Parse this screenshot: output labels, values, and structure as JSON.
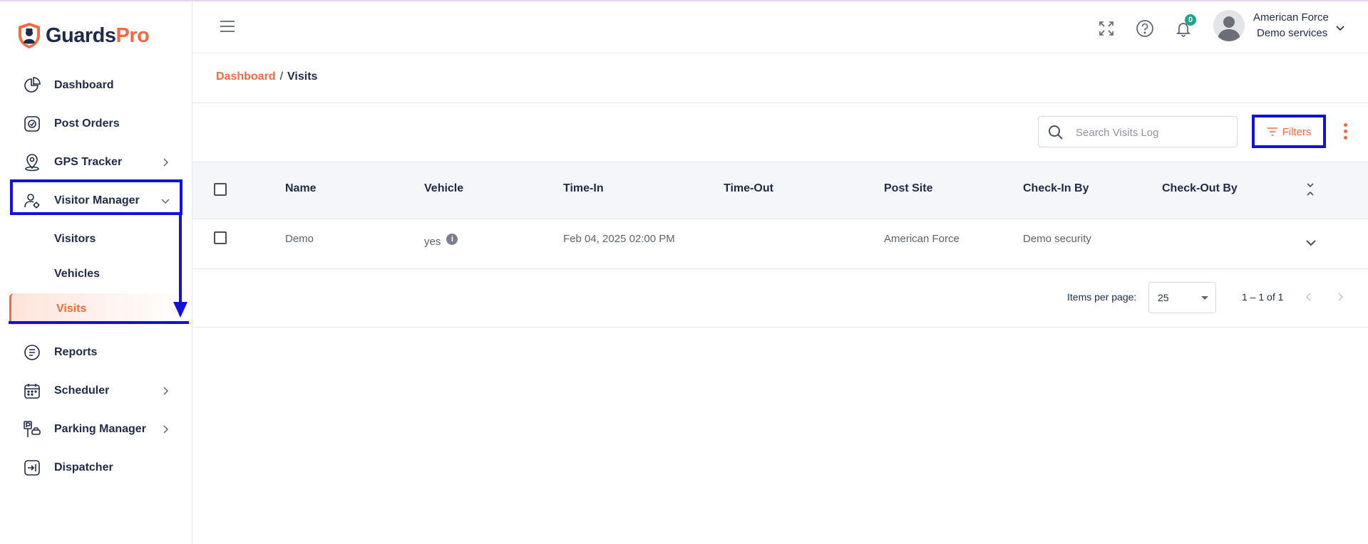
{
  "brand": {
    "name_part1": "Guards",
    "name_part2": "Pro",
    "accent_color": "#f26a3d",
    "annotation_color": "#1010e0"
  },
  "sidebar": {
    "items": [
      {
        "label": "Dashboard",
        "icon": "pie-chart-icon"
      },
      {
        "label": "Post Orders",
        "icon": "id-badge-icon"
      },
      {
        "label": "GPS Tracker",
        "icon": "map-pin-icon"
      },
      {
        "label": "Visitor Manager",
        "icon": "user-gear-icon"
      },
      {
        "label": "Reports",
        "icon": "report-icon"
      },
      {
        "label": "Scheduler",
        "icon": "calendar-icon"
      },
      {
        "label": "Parking Manager",
        "icon": "parking-icon"
      },
      {
        "label": "Dispatcher",
        "icon": "dispatch-icon"
      }
    ],
    "visitor_sub": [
      {
        "label": "Visitors"
      },
      {
        "label": "Vehicles"
      },
      {
        "label": "Visits",
        "active": true
      }
    ]
  },
  "header": {
    "notification_count": "0",
    "user_name": "American Force",
    "user_org": "Demo services"
  },
  "breadcrumb": {
    "root": "Dashboard",
    "separator": "/",
    "current": "Visits"
  },
  "toolbar": {
    "search_placeholder": "Search Visits Log",
    "filters_label": "Filters"
  },
  "table": {
    "columns": [
      "Name",
      "Vehicle",
      "Time-In",
      "Time-Out",
      "Post Site",
      "Check-In By",
      "Check-Out By"
    ],
    "rows": [
      {
        "name": "Demo",
        "vehicle": "yes",
        "time_in": "Feb 04, 2025 02:00 PM",
        "time_out": "",
        "post_site": "American Force",
        "check_in_by": "Demo security",
        "check_out_by": ""
      }
    ]
  },
  "paginator": {
    "label": "Items per page:",
    "page_size": "25",
    "range": "1 – 1 of 1"
  }
}
